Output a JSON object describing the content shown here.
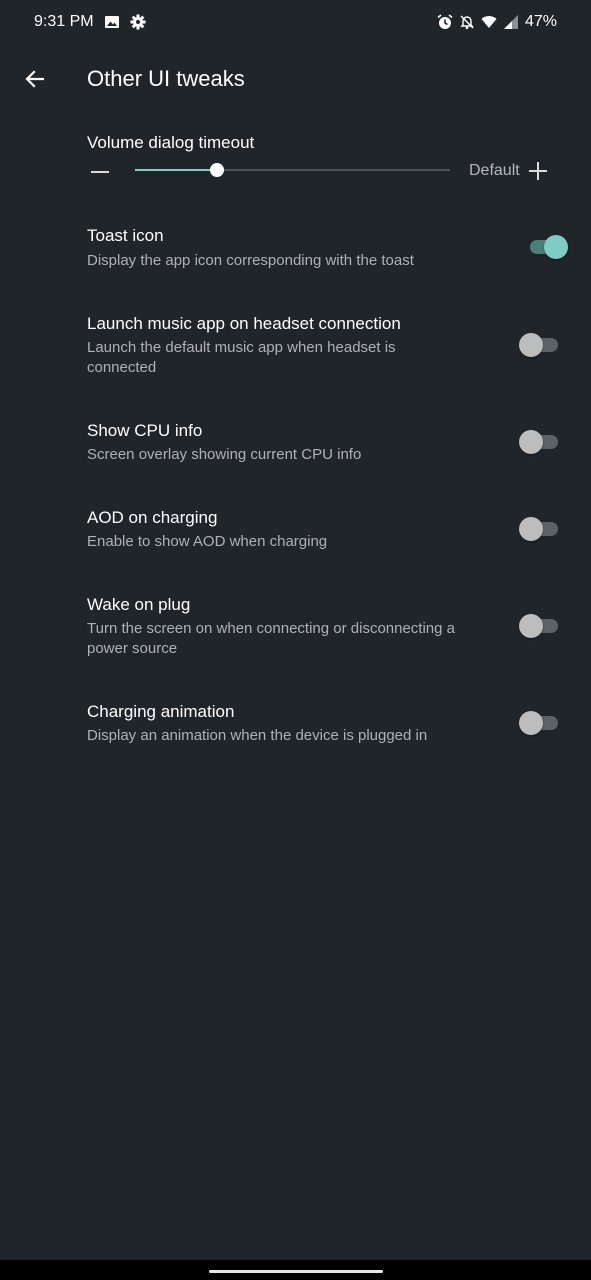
{
  "status_bar": {
    "time": "9:31 PM",
    "left_icons": [
      "image-icon",
      "gear-icon"
    ],
    "right_icons": [
      "alarm-icon",
      "bell-off-icon",
      "wifi-icon",
      "signal-icon"
    ],
    "battery": "47%"
  },
  "app_bar": {
    "back_icon": "arrow-left-icon",
    "title": "Other UI tweaks"
  },
  "volume_slider": {
    "title": "Volume dialog timeout",
    "value_label": "Default",
    "fraction": 0.26
  },
  "preferences": [
    {
      "title": "Toast icon",
      "summary": "Display the app icon corresponding with the toast",
      "enabled": true
    },
    {
      "title": "Launch music app on headset connection",
      "summary": "Launch the default music app when headset is connected",
      "enabled": false
    },
    {
      "title": "Show CPU info",
      "summary": "Screen overlay showing current CPU info",
      "enabled": false
    },
    {
      "title": "AOD on charging",
      "summary": "Enable to show AOD when charging",
      "enabled": false
    },
    {
      "title": "Wake on plug",
      "summary": "Turn the screen on when connecting or disconnecting a power source",
      "enabled": false
    },
    {
      "title": "Charging animation",
      "summary": "Display an animation when the device is plugged in",
      "enabled": false
    }
  ],
  "colors": {
    "background": "#202529",
    "accent": "#80cbc4",
    "text_secondary": "#aeb2b5"
  }
}
